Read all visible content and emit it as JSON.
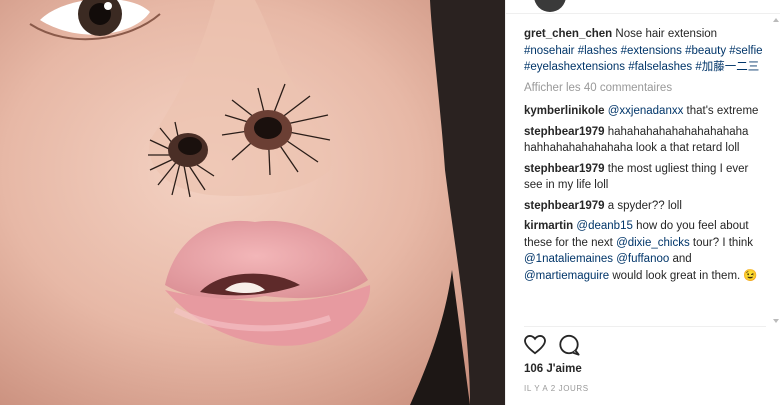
{
  "post": {
    "caption": {
      "username": "gret_chen_chen",
      "text": "Nose hair extension",
      "hashtags": [
        "#nosehair",
        "#lashes",
        "#extensions",
        "#beauty",
        "#selfie",
        "#eyelashextensions",
        "#falselashes",
        "#加藤一二三"
      ]
    },
    "view_all_comments": "Afficher les 40 commentaires",
    "comments": [
      {
        "user": "kymberlinikole",
        "parts": [
          {
            "t": "@xxjenadanxx",
            "link": true
          },
          {
            "t": " that's extreme"
          }
        ]
      },
      {
        "user": "stephbear1979",
        "parts": [
          {
            "t": "hahahahahahahahahahaha hahhahahahahahaha look a that retard loll"
          }
        ]
      },
      {
        "user": "stephbear1979",
        "parts": [
          {
            "t": "the most ugliest thing I ever see in my life loll"
          }
        ]
      },
      {
        "user": "stephbear1979",
        "parts": [
          {
            "t": "a spyder?? loll"
          }
        ]
      },
      {
        "user": "kirmartin",
        "parts": [
          {
            "t": "@deanb15",
            "link": true
          },
          {
            "t": " how do you feel about these for the next "
          },
          {
            "t": "@dixie_chicks",
            "link": true
          },
          {
            "t": " tour? I think "
          },
          {
            "t": "@1nataliemaines",
            "link": true
          },
          {
            "t": " "
          },
          {
            "t": "@fuffanoo",
            "link": true
          },
          {
            "t": " and "
          },
          {
            "t": "@martiemaguire",
            "link": true
          },
          {
            "t": " would look great in them. 😉"
          }
        ]
      }
    ],
    "likes": "106 J'aime",
    "timestamp": "IL Y A 2 JOURS",
    "icons": {
      "like": "heart-icon",
      "comment": "comment-bubble-icon"
    },
    "colors": {
      "link": "#003569",
      "muted": "#999999",
      "text": "#262626"
    }
  }
}
